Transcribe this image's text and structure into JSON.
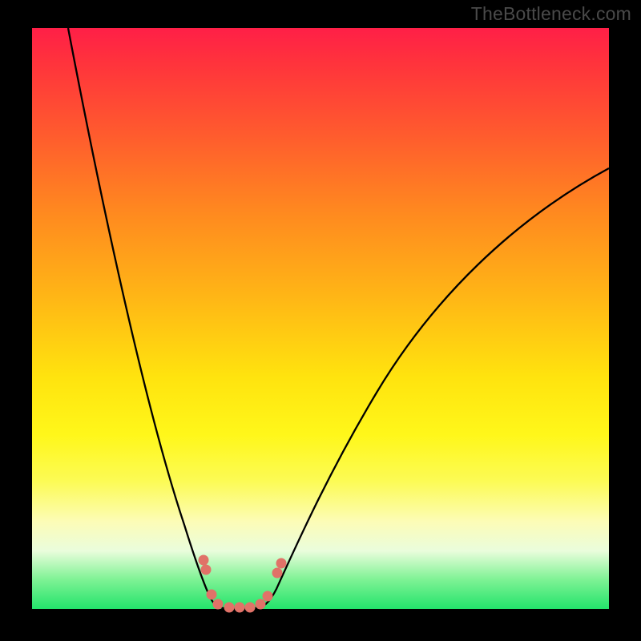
{
  "watermark": "TheBottleneck.com",
  "chart_data": {
    "type": "line",
    "title": "",
    "xlabel": "",
    "ylabel": "",
    "xlim": [
      0,
      100
    ],
    "ylim": [
      0,
      100
    ],
    "background_gradient": {
      "top_color": "#ff1f47",
      "mid_color": "#fff71a",
      "bottom_color": "#23e36b"
    },
    "series": [
      {
        "name": "bottleneck-curve",
        "x": [
          6,
          10,
          15,
          20,
          25,
          28,
          30,
          31,
          33,
          35,
          37,
          40,
          45,
          55,
          70,
          85,
          100
        ],
        "y": [
          100,
          80,
          58,
          38,
          20,
          10,
          4,
          1,
          0,
          0,
          1,
          5,
          15,
          35,
          58,
          70,
          76
        ]
      }
    ],
    "markers": {
      "name": "highlighted-points",
      "color": "#e07268",
      "x": [
        29.5,
        30,
        31,
        32,
        34,
        36,
        38,
        39.5,
        41,
        42.5,
        43
      ],
      "y": [
        8,
        7,
        3,
        1,
        0,
        0,
        0,
        1,
        2,
        6,
        8
      ]
    },
    "annotations": [
      {
        "text": "TheBottleneck.com",
        "position": "top-right"
      }
    ]
  }
}
